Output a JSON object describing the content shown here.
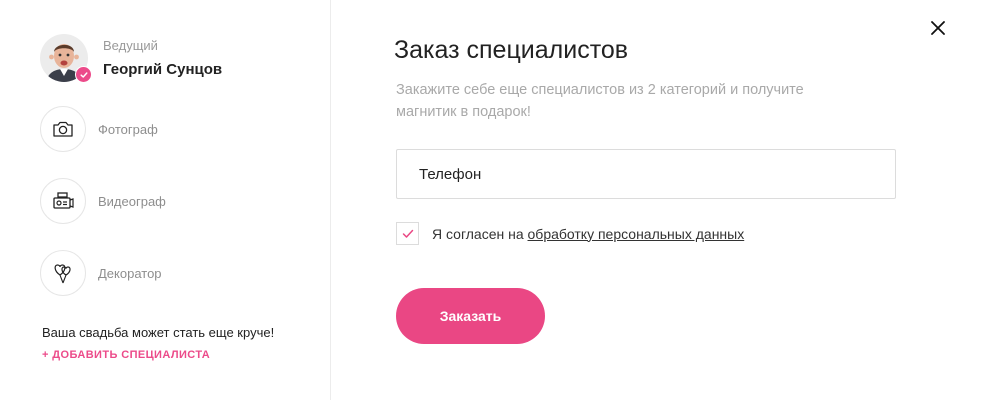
{
  "sidebar": {
    "host": {
      "role": "Ведущий",
      "name": "Георгий Сунцов",
      "avatar_icon": "person-avatar",
      "badge_icon": "check-icon"
    },
    "specialists": [
      {
        "label": "Фотограф",
        "icon": "camera-icon"
      },
      {
        "label": "Видеограф",
        "icon": "video-camera-icon"
      },
      {
        "label": "Декоратор",
        "icon": "balloons-icon"
      }
    ],
    "promo_text": "Ваша свадьба может стать еще круче!",
    "add_link": "+ добавить специалиста"
  },
  "modal": {
    "title": "Заказ специалистов",
    "subtitle": "Закажите себе еще специалистов из 2 категорий и получите магнитик в подарок!",
    "phone": {
      "placeholder": "Телефон",
      "value": ""
    },
    "consent": {
      "checked": true,
      "text": "Я согласен на",
      "link": "обработку персональных данных"
    },
    "submit_label": "Заказать",
    "close_icon": "close-icon"
  },
  "colors": {
    "accent": "#ea4784",
    "muted_text": "#a9a9a9",
    "border": "#dcdcdc"
  }
}
